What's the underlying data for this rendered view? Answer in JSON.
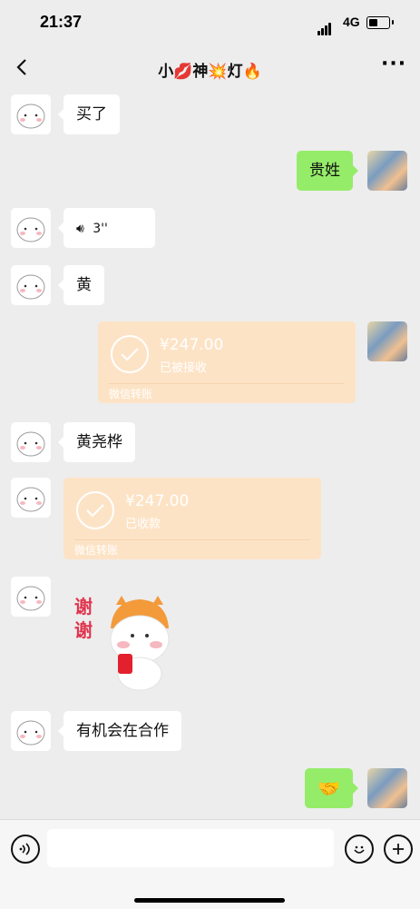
{
  "status_bar": {
    "time": "21:37",
    "network": "4G"
  },
  "nav": {
    "back_icon": "chevron-left-icon",
    "title": "小💋神💥灯🔥",
    "more": "···"
  },
  "messages": [
    {
      "side": "left",
      "type": "text",
      "text": "买了"
    },
    {
      "side": "right",
      "type": "text",
      "text": "贵姓"
    },
    {
      "side": "left",
      "type": "voice",
      "duration": "3''"
    },
    {
      "side": "left",
      "type": "text",
      "text": "黄"
    },
    {
      "side": "right",
      "type": "transfer",
      "amount": "¥247.00",
      "status": "已被接收",
      "brand": "微信转账"
    },
    {
      "side": "left",
      "type": "text",
      "text": "黄尧桦"
    },
    {
      "side": "left",
      "type": "transfer",
      "amount": "¥247.00",
      "status": "已收款",
      "brand": "微信转账"
    },
    {
      "side": "left",
      "type": "sticker",
      "text_top": "谢",
      "text_bottom": "谢"
    },
    {
      "side": "left",
      "type": "text",
      "text": "有机会在合作"
    },
    {
      "side": "right",
      "type": "emoji",
      "text": "🤝"
    }
  ],
  "colors": {
    "background": "#ededed",
    "my_bubble": "#95ec69",
    "transfer": "#fde3c6"
  }
}
